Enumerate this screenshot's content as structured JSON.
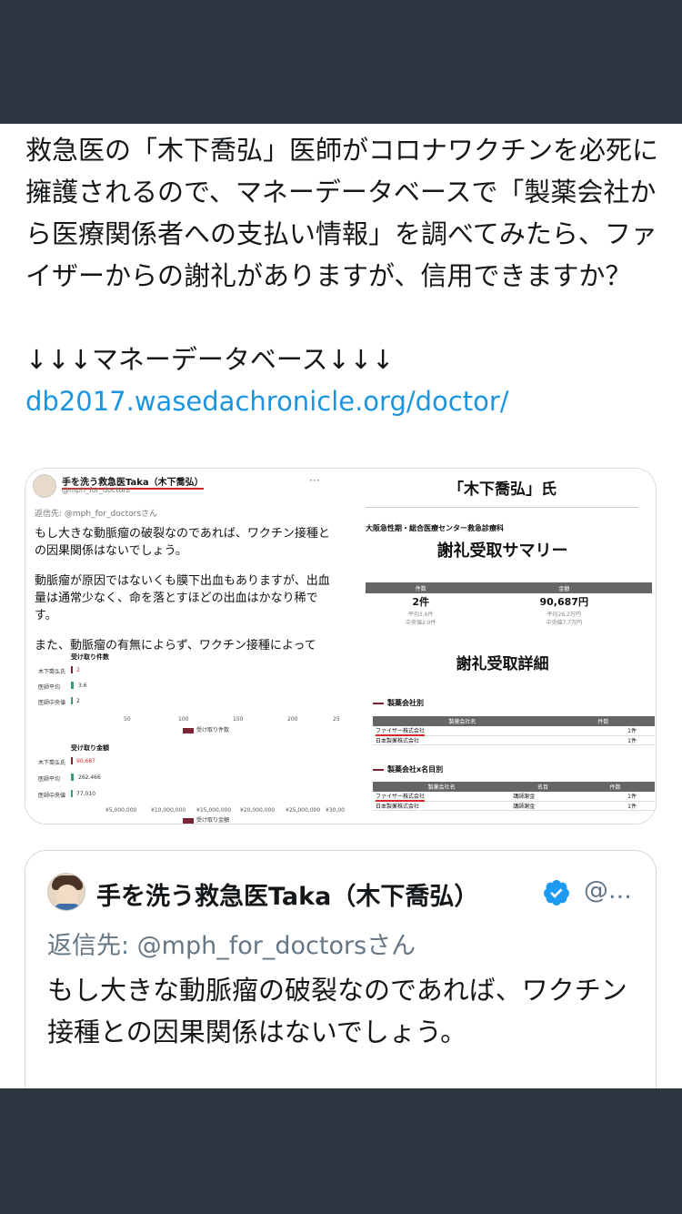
{
  "tweet": {
    "text": "救急医の「木下喬弘」医師がコロナワクチンを必死に擁護されるので、マネーデータベースで「製薬会社から医療関係者への支払い情報」を調べてみたら、ファイザーからの謝礼がありますが、信用できますか？",
    "arrows": "↓↓↓マネーデータベース↓↓↓",
    "link": "db2017.wasedachronicle.org/doctor/"
  },
  "media_left": {
    "name": "手を洗う救急医Taka（木下喬弘）",
    "handle": "@mph_for_doctors",
    "reply_to": "返信先: @mph_for_doctorsさん",
    "body": [
      "もし大きな動脈瘤の破裂なのであれば、ワクチン接種との因果関係はないでしょう。",
      "動脈瘤が原因ではないくも膜下出血もありますが、出血量は通常少なく、命を落とすほどの出血はかなり稀です。",
      "また、動脈瘤の有無によらず、ワクチン接種によって"
    ],
    "chart1_title": "受け取り件数",
    "chart1_rows": [
      "木下喬弘氏",
      "医師平均",
      "医師中央値"
    ],
    "chart1_values": [
      "2",
      "3.6",
      "2"
    ],
    "chart1_ticks": [
      "50",
      "100",
      "150",
      "200",
      "25"
    ],
    "chart1_legend": "受け取り件数",
    "chart2_title": "受け取り金額",
    "chart2_rows": [
      "木下喬弘氏",
      "医師平均",
      "医師中央値"
    ],
    "chart2_values": [
      "90,687",
      "262,466",
      "77,010"
    ],
    "chart2_ticks": [
      "¥5,000,000",
      "¥10,000,000",
      "¥15,000,000",
      "¥20,000,000",
      "¥25,000,000",
      "¥30,00"
    ],
    "chart2_legend": "受け取り金額"
  },
  "media_right": {
    "title": "「木下喬弘」氏",
    "org": "大阪急性期・総合医療センター救急診療科",
    "summary_title": "謝礼受取サマリー",
    "col_count": "件数",
    "col_amount": "金額",
    "count": "2件",
    "amount": "90,687円",
    "count_sub1": "平均3.6件",
    "count_sub2": "中央値2.0件",
    "amount_sub1": "平均26.2万円",
    "amount_sub2": "中央値7.7万円",
    "detail_title": "謝礼受取詳細",
    "section1": "製薬会社別",
    "section1_header": [
      "製薬会社名",
      "件数"
    ],
    "section1_rows": [
      [
        "ファイザー株式会社",
        "1件"
      ],
      [
        "日本製薬株式会社",
        "1件"
      ]
    ],
    "section2": "製薬会社x名目別",
    "section2_header": [
      "製薬会社名",
      "名目",
      "件数"
    ],
    "section2_rows": [
      [
        "ファイザー株式会社",
        "講師謝金",
        "1件"
      ],
      [
        "日本製薬株式会社",
        "講師謝金",
        "1件"
      ]
    ]
  },
  "quote": {
    "name": "手を洗う救急医Taka（木下喬弘）",
    "handle": "@...",
    "reply_to": "返信先: @mph_for_doctorsさん",
    "text": "もし大きな動脈瘤の破裂なのであれば、ワクチン接種との因果関係はないでしょう。",
    "verified_icon": "verified-badge-icon",
    "verified_color": "#1d9bf0"
  }
}
